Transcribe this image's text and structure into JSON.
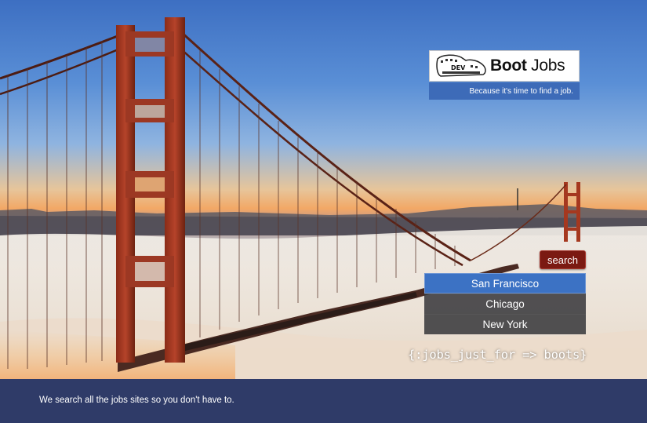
{
  "brand": {
    "logo_mark_text": "DEV",
    "name_bold": "Boot",
    "name_regular": "Jobs",
    "tagline": "Because it's time to find a job."
  },
  "search": {
    "button_label": "search",
    "cities": [
      {
        "label": "San Francisco",
        "selected": true
      },
      {
        "label": "Chicago",
        "selected": false
      },
      {
        "label": "New York",
        "selected": false
      }
    ]
  },
  "code_tagline": "{:jobs_just_for => boots}",
  "footer": {
    "text": "We search all the jobs sites so you don't have to."
  },
  "colors": {
    "accent_blue": "#3c72c4",
    "search_red": "#7b1a12",
    "footer_navy": "#2f3b68"
  }
}
